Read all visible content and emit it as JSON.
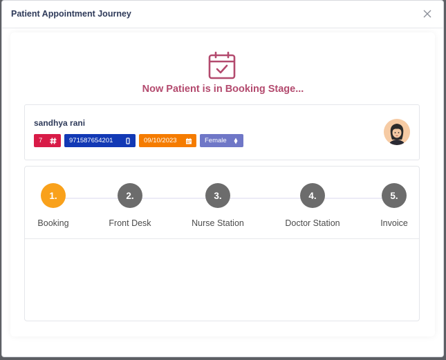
{
  "modal": {
    "title": "Patient Appointment Journey",
    "close_icon": "close-icon"
  },
  "stage": {
    "icon": "calendar-check-icon",
    "message": "Now Patient is in Booking Stage...",
    "accent_color": "#b34a6e"
  },
  "patient": {
    "name": "sandhya rani",
    "badges": [
      {
        "value": "7",
        "icon": "hash-icon",
        "color": "#d81b47"
      },
      {
        "value": "971587654201",
        "icon": "mobile-icon",
        "color": "#1239b5"
      },
      {
        "value": "09/10/2023",
        "icon": "calendar-icon",
        "color": "#f57c00"
      },
      {
        "value": "Female",
        "icon": "gender-icon",
        "color": "#6f77c7"
      }
    ],
    "avatar": "female-avatar-icon"
  },
  "steps": [
    {
      "number": "1.",
      "label": "Booking",
      "active": true
    },
    {
      "number": "2.",
      "label": "Front Desk",
      "active": false
    },
    {
      "number": "3.",
      "label": "Nurse Station",
      "active": false
    },
    {
      "number": "4.",
      "label": "Doctor Station",
      "active": false
    },
    {
      "number": "5.",
      "label": "Invoice",
      "active": false
    }
  ],
  "colors": {
    "active_step": "#f9a11b",
    "inactive_step": "#6c6c6c"
  }
}
